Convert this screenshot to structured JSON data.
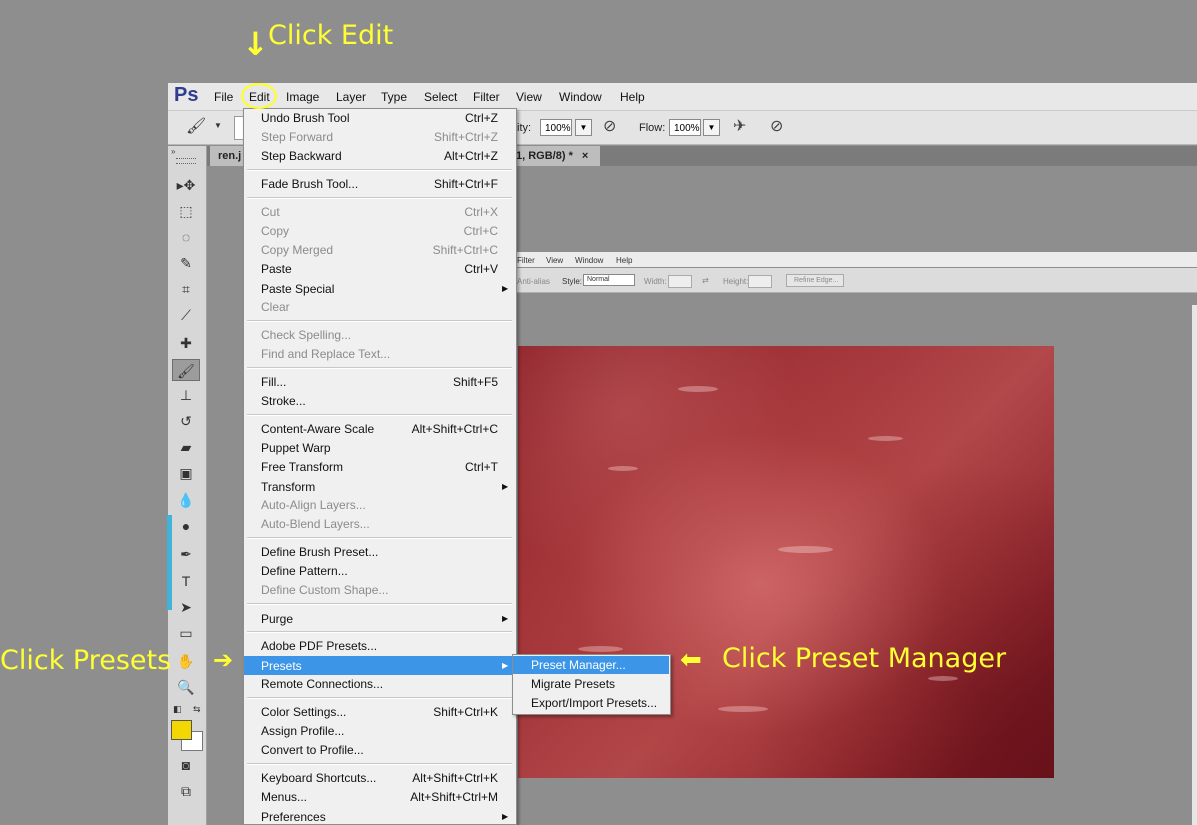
{
  "app": {
    "logo": "Ps"
  },
  "menubar": [
    "File",
    "Edit",
    "Image",
    "Layer",
    "Type",
    "Select",
    "Filter",
    "View",
    "Window",
    "Help"
  ],
  "options_bar": {
    "opacity_label": "ity:",
    "opacity_value": "100%",
    "flow_label": "Flow:",
    "flow_value": "100%"
  },
  "tabs": {
    "tab1": "ren.j",
    "tab2": "1, RGB/8) *",
    "close": "×"
  },
  "inner_screenshot": {
    "menu": [
      "Filter",
      "View",
      "Window",
      "Help"
    ],
    "antialias": "Anti-alias",
    "style_label": "Style:",
    "style_value": "Normal",
    "width_label": "Width:",
    "height_label": "Height:",
    "refine_button": "Refine Edge..."
  },
  "edit_menu": {
    "items": [
      {
        "label": "Undo Brush Tool",
        "shortcut": "Ctrl+Z",
        "disabled": false
      },
      {
        "label": "Step Forward",
        "shortcut": "Shift+Ctrl+Z",
        "disabled": true
      },
      {
        "label": "Step Backward",
        "shortcut": "Alt+Ctrl+Z",
        "disabled": false
      },
      {
        "label": "Fade Brush Tool...",
        "shortcut": "Shift+Ctrl+F",
        "disabled": false
      },
      {
        "label": "Cut",
        "shortcut": "Ctrl+X",
        "disabled": true
      },
      {
        "label": "Copy",
        "shortcut": "Ctrl+C",
        "disabled": true
      },
      {
        "label": "Copy Merged",
        "shortcut": "Shift+Ctrl+C",
        "disabled": true
      },
      {
        "label": "Paste",
        "shortcut": "Ctrl+V",
        "disabled": false
      },
      {
        "label": "Paste Special",
        "shortcut": "",
        "disabled": false,
        "submenu": true
      },
      {
        "label": "Clear",
        "shortcut": "",
        "disabled": true
      },
      {
        "label": "Check Spelling...",
        "shortcut": "",
        "disabled": true
      },
      {
        "label": "Find and Replace Text...",
        "shortcut": "",
        "disabled": true
      },
      {
        "label": "Fill...",
        "shortcut": "Shift+F5",
        "disabled": false
      },
      {
        "label": "Stroke...",
        "shortcut": "",
        "disabled": false
      },
      {
        "label": "Content-Aware Scale",
        "shortcut": "Alt+Shift+Ctrl+C",
        "disabled": false
      },
      {
        "label": "Puppet Warp",
        "shortcut": "",
        "disabled": false
      },
      {
        "label": "Free Transform",
        "shortcut": "Ctrl+T",
        "disabled": false
      },
      {
        "label": "Transform",
        "shortcut": "",
        "disabled": false,
        "submenu": true
      },
      {
        "label": "Auto-Align Layers...",
        "shortcut": "",
        "disabled": true
      },
      {
        "label": "Auto-Blend Layers...",
        "shortcut": "",
        "disabled": true
      },
      {
        "label": "Define Brush Preset...",
        "shortcut": "",
        "disabled": false
      },
      {
        "label": "Define Pattern...",
        "shortcut": "",
        "disabled": false
      },
      {
        "label": "Define Custom Shape...",
        "shortcut": "",
        "disabled": true
      },
      {
        "label": "Purge",
        "shortcut": "",
        "disabled": false,
        "submenu": true
      },
      {
        "label": "Adobe PDF Presets...",
        "shortcut": "",
        "disabled": false
      },
      {
        "label": "Presets",
        "shortcut": "",
        "disabled": false,
        "submenu": true,
        "highlighted": true
      },
      {
        "label": "Remote Connections...",
        "shortcut": "",
        "disabled": false
      },
      {
        "label": "Color Settings...",
        "shortcut": "Shift+Ctrl+K",
        "disabled": false
      },
      {
        "label": "Assign Profile...",
        "shortcut": "",
        "disabled": false
      },
      {
        "label": "Convert to Profile...",
        "shortcut": "",
        "disabled": false
      },
      {
        "label": "Keyboard Shortcuts...",
        "shortcut": "Alt+Shift+Ctrl+K",
        "disabled": false
      },
      {
        "label": "Menus...",
        "shortcut": "Alt+Shift+Ctrl+M",
        "disabled": false
      },
      {
        "label": "Preferences",
        "shortcut": "",
        "disabled": false,
        "submenu": true
      }
    ]
  },
  "presets_submenu": [
    "Preset Manager...",
    "Migrate Presets",
    "Export/Import Presets..."
  ],
  "annotations": {
    "click_edit": "Click Edit",
    "click_presets": "Click Presets",
    "click_preset_manager": "Click Preset Manager",
    "arrow_down": "↓",
    "arrow_right": "➔",
    "arrow_left": "⬅"
  },
  "colors": {
    "highlight": "#3d95e8",
    "annotation": "#ffff33",
    "foreground_swatch": "#f2d800"
  }
}
